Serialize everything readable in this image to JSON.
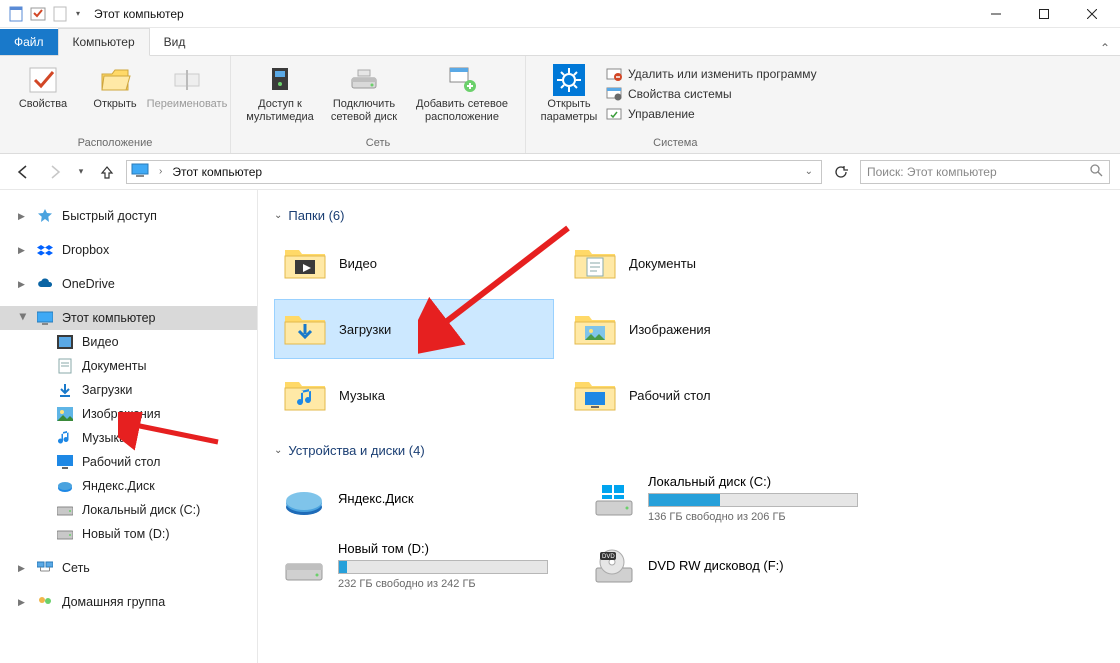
{
  "window": {
    "title": "Этот компьютер"
  },
  "ribbon": {
    "tabs": {
      "file": "Файл",
      "computer": "Компьютер",
      "view": "Вид"
    },
    "location": {
      "properties": "Свойства",
      "open": "Открыть",
      "rename": "Переименовать",
      "group": "Расположение"
    },
    "network": {
      "media": "Доступ к\nмультимедиа",
      "mapdrive": "Подключить\nсетевой диск",
      "addnet": "Добавить сетевое\nрасположение",
      "group": "Сеть"
    },
    "system": {
      "open_settings": "Открыть\nпараметры",
      "uninstall": "Удалить или изменить программу",
      "sysprops": "Свойства системы",
      "manage": "Управление",
      "group": "Система"
    }
  },
  "nav": {
    "crumb_root": "Этот компьютер",
    "search_placeholder": "Поиск: Этот компьютер"
  },
  "sidebar": {
    "quick": "Быстрый доступ",
    "dropbox": "Dropbox",
    "onedrive": "OneDrive",
    "thispc": "Этот компьютер",
    "videos": "Видео",
    "documents": "Документы",
    "downloads": "Загрузки",
    "pictures": "Изображения",
    "music": "Музыка",
    "desktop": "Рабочий стол",
    "yadisk": "Яндекс.Диск",
    "localc": "Локальный диск (C:)",
    "newvol": "Новый том (D:)",
    "network": "Сеть",
    "homegroup": "Домашняя группа"
  },
  "content": {
    "folders_header": "Папки (6)",
    "devices_header": "Устройства и диски (4)",
    "folders": {
      "videos": "Видео",
      "documents": "Документы",
      "downloads": "Загрузки",
      "pictures": "Изображения",
      "music": "Музыка",
      "desktop": "Рабочий стол"
    },
    "drives": {
      "yadisk": {
        "title": "Яндекс.Диск"
      },
      "c": {
        "title": "Локальный диск (C:)",
        "sub": "136 ГБ свободно из 206 ГБ",
        "fill_pct": 34
      },
      "d": {
        "title": "Новый том (D:)",
        "sub": "232 ГБ свободно из 242 ГБ",
        "fill_pct": 4
      },
      "dvd": {
        "title": "DVD RW дисковод (F:)"
      }
    }
  }
}
